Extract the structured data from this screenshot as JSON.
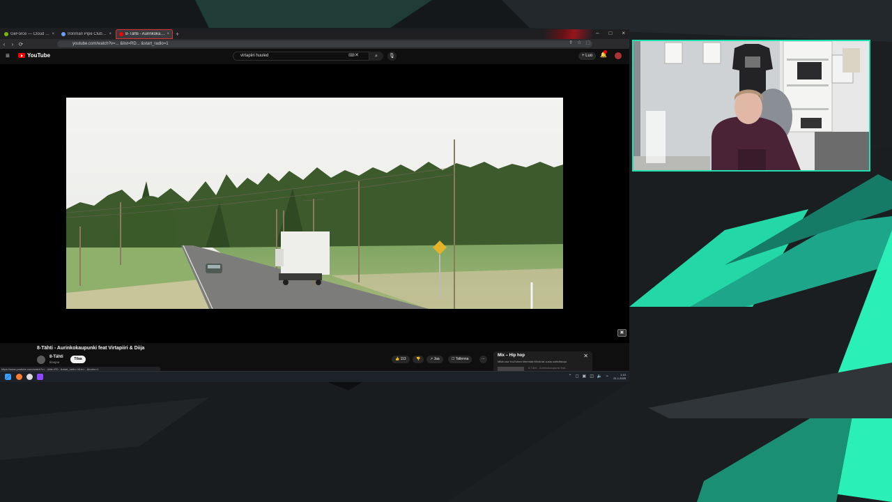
{
  "colors": {
    "overlay_dark": "#161a1d",
    "overlay_teal": "#27e0ad",
    "youtube_red": "#ff0000",
    "webcam_border": "#20e0b0"
  },
  "browser": {
    "tabs": [
      {
        "label": "GeForce — Cloud Streaming Ser",
        "close": "×",
        "active": false
      },
      {
        "label": "Ironman Pipe Club | Topic",
        "close": "×",
        "active": false
      },
      {
        "label": "8-Tähti - Aurinkokaupu",
        "close": "×",
        "active": true
      }
    ],
    "new_tab": "+",
    "window_controls": [
      "–",
      "□",
      "×"
    ],
    "url": "youtube.com/watch?v=... &list=RD... &start_radio=1",
    "nav": {
      "back": "‹",
      "forward": "›",
      "reload": "⟳"
    }
  },
  "youtube": {
    "menu_icon": "≡",
    "logo_text": "YouTube",
    "search_query": "virtapiiri huuled",
    "search_clear": "✕",
    "search_icon": "⌕",
    "mic_icon": "🎙",
    "create_label": "+ Luo",
    "bell_icon": "🔔",
    "video": {
      "title": "8-Tähti - Aurinkokaupunki feat Virtapiiri & Diija",
      "channel": "8-Tähti",
      "subscribers": "tilaajaa",
      "subscribe_label": "Tilaa",
      "like_count": "👍 113",
      "dislike": "👎",
      "share": "↗ Jaa",
      "save": "☐ Tallenna",
      "more": "⋯"
    },
    "mix": {
      "title": "Mix – Hip hop",
      "subtitle": "Mikä osa YouTuben tekemää Mixiä tai uusia soittolistoja",
      "close": "✕",
      "next_item": "8-Tähti - Aurinkokaupunki feat..."
    },
    "status_url": "https://www.youtube.com/watch?v=...&list=RD...&start_radio=1&rv=...&index=1"
  },
  "taskbar": {
    "tray_icons": [
      "⌃",
      "◻",
      "▣",
      "◫",
      "🔈",
      "⌁"
    ],
    "time": "1.10",
    "date": "21.1.2025"
  }
}
